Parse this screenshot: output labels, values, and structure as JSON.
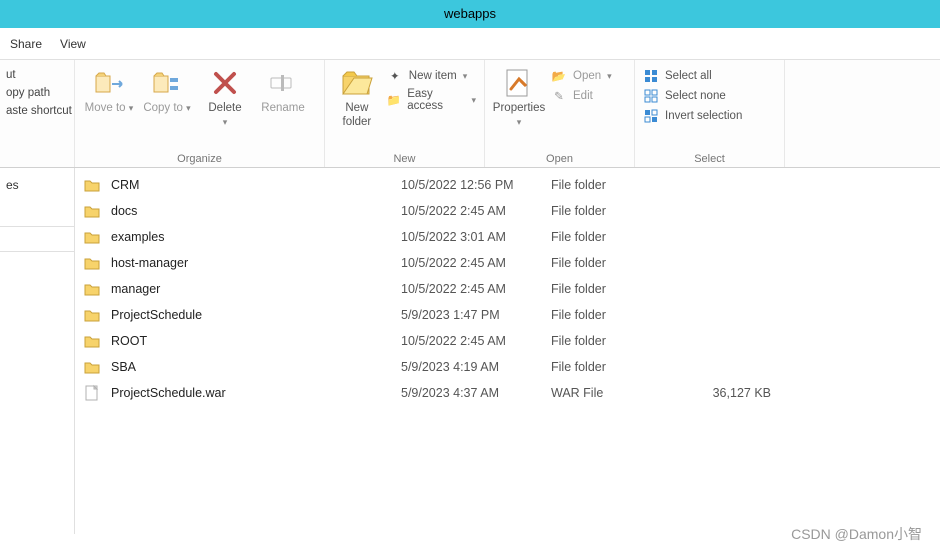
{
  "title": "webapps",
  "tabs": {
    "share": "Share",
    "view": "View"
  },
  "ribbon": {
    "clipboard": {
      "cut": "ut",
      "copypath": "opy path",
      "paste": "aste shortcut"
    },
    "organize": {
      "label": "Organize",
      "move": "Move to",
      "copy": "Copy to",
      "delete": "Delete",
      "rename": "Rename"
    },
    "new": {
      "label": "New",
      "newfolder": "New folder",
      "newitem": "New item",
      "easy": "Easy access"
    },
    "open": {
      "label": "Open",
      "properties": "Properties",
      "open": "Open",
      "edit": "Edit"
    },
    "select": {
      "label": "Select",
      "all": "Select all",
      "none": "Select none",
      "invert": "Invert selection"
    }
  },
  "sidebar": {
    "item1": "es"
  },
  "files": [
    {
      "name": "CRM",
      "date": "10/5/2022 12:56 PM",
      "type": "File folder",
      "size": "",
      "icon": "folder"
    },
    {
      "name": "docs",
      "date": "10/5/2022 2:45 AM",
      "type": "File folder",
      "size": "",
      "icon": "folder"
    },
    {
      "name": "examples",
      "date": "10/5/2022 3:01 AM",
      "type": "File folder",
      "size": "",
      "icon": "folder"
    },
    {
      "name": "host-manager",
      "date": "10/5/2022 2:45 AM",
      "type": "File folder",
      "size": "",
      "icon": "folder"
    },
    {
      "name": "manager",
      "date": "10/5/2022 2:45 AM",
      "type": "File folder",
      "size": "",
      "icon": "folder"
    },
    {
      "name": "ProjectSchedule",
      "date": "5/9/2023 1:47 PM",
      "type": "File folder",
      "size": "",
      "icon": "folder"
    },
    {
      "name": "ROOT",
      "date": "10/5/2022 2:45 AM",
      "type": "File folder",
      "size": "",
      "icon": "folder"
    },
    {
      "name": "SBA",
      "date": "5/9/2023 4:19 AM",
      "type": "File folder",
      "size": "",
      "icon": "folder"
    },
    {
      "name": "ProjectSchedule.war",
      "date": "5/9/2023 4:37 AM",
      "type": "WAR File",
      "size": "36,127 KB",
      "icon": "file"
    }
  ],
  "watermark": "CSDN @Damon小智"
}
